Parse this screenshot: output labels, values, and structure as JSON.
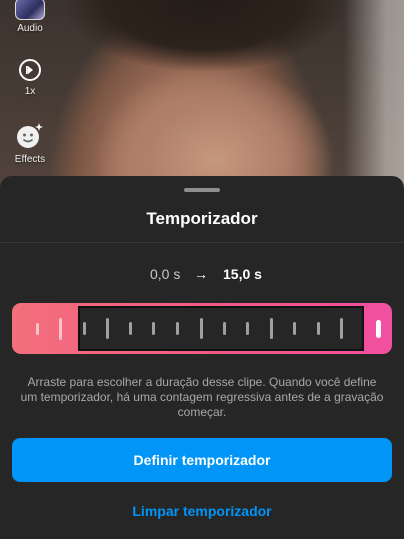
{
  "camera_tools": [
    {
      "label": "Audio",
      "icon": "audio-thumbnail-icon"
    },
    {
      "label": "1x",
      "icon": "speed-icon"
    },
    {
      "label": "Effects",
      "icon": "effects-icon"
    }
  ],
  "sheet": {
    "title": "Temporizador",
    "start_time": "0,0 s",
    "arrow_icon": "arrow-right-icon",
    "end_time": "15,0 s",
    "description": "Arraste para escolher a duração desse clipe. Quando você define um temporizador, há uma contagem regressiva antes de a gravação começar.",
    "primary_button": "Definir temporizador",
    "secondary_button": "Limpar temporizador"
  },
  "colors": {
    "accent_blue": "#0095f6",
    "timeline_gradient_start": "#f36f7b",
    "timeline_gradient_end": "#f14fa0",
    "sheet_background": "#262626"
  }
}
